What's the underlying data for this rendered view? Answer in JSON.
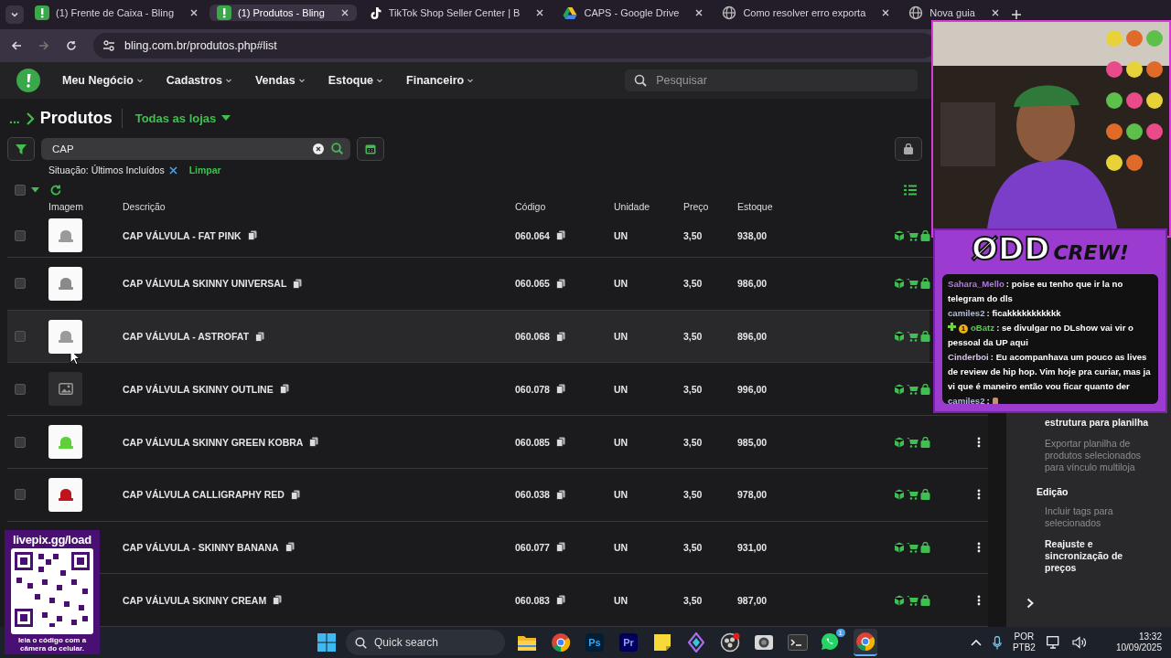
{
  "browser": {
    "tabs": [
      {
        "title": "(1) Frente de Caixa - Bling",
        "kind": "bling",
        "selected": false
      },
      {
        "title": "(1) Produtos - Bling",
        "kind": "bling",
        "selected": true
      },
      {
        "title": "TikTok Shop Seller Center | B",
        "kind": "note",
        "selected": false
      },
      {
        "title": "CAPS - Google Drive",
        "kind": "drive",
        "selected": false
      },
      {
        "title": "Como resolver erro exporta",
        "kind": "globe",
        "selected": false
      },
      {
        "title": "Nova guia",
        "kind": "globe",
        "selected": false
      }
    ],
    "url": "bling.com.br/produtos.php#list"
  },
  "nav": {
    "items": [
      "Meu Negócio",
      "Cadastros",
      "Vendas",
      "Estoque",
      "Financeiro"
    ],
    "search_placeholder": "Pesquisar"
  },
  "page": {
    "breadcrumb": "...",
    "title": "Produtos",
    "store_filter": "Todas as lojas",
    "search_value": "CAP",
    "filter_chip": "Situação: Últimos Incluídos",
    "clear_link": "Limpar"
  },
  "table": {
    "select_all_checked": false,
    "columns": [
      "Imagem",
      "Descrição",
      "Código",
      "Unidade",
      "Preço",
      "Estoque"
    ],
    "rows": [
      {
        "checked": false,
        "image": {
          "kind": "thumbnail",
          "color": "#9a9a9a"
        },
        "description": "CAP VÁLVULA - FAT PINK",
        "code": "060.064",
        "unit": "UN",
        "price": "3,50",
        "stock": "938,00",
        "highlighted": false
      },
      {
        "checked": false,
        "image": {
          "kind": "thumbnail",
          "color": "#8a8a8a"
        },
        "description": "CAP VÁLVULA SKINNY UNIVERSAL",
        "code": "060.065",
        "unit": "UN",
        "price": "3,50",
        "stock": "986,00",
        "highlighted": false
      },
      {
        "checked": false,
        "image": {
          "kind": "thumbnail",
          "color": "#9a9a9a"
        },
        "description": "CAP VÁLVULA - ASTROFAT",
        "code": "060.068",
        "unit": "UN",
        "price": "3,50",
        "stock": "896,00",
        "highlighted": true
      },
      {
        "checked": false,
        "image": {
          "kind": "placeholder"
        },
        "description": "CAP VÁLVULA SKINNY OUTLINE",
        "code": "060.078",
        "unit": "UN",
        "price": "3,50",
        "stock": "996,00",
        "highlighted": false
      },
      {
        "checked": false,
        "image": {
          "kind": "thumbnail",
          "color": "#5fcf3a"
        },
        "description": "CAP VÁLVULA SKINNY GREEN KOBRA",
        "code": "060.085",
        "unit": "UN",
        "price": "3,50",
        "stock": "985,00",
        "highlighted": false,
        "actions_menu": true
      },
      {
        "checked": false,
        "image": {
          "kind": "thumbnail",
          "color": "#c0141c"
        },
        "description": "CAP VÁLVULA CALLIGRAPHY RED",
        "code": "060.038",
        "unit": "UN",
        "price": "3,50",
        "stock": "978,00",
        "highlighted": false,
        "actions_menu": true
      },
      {
        "image": {
          "kind": "hidden"
        },
        "description": "CAP VÁLVULA - SKINNY BANANA",
        "code": "060.077",
        "unit": "UN",
        "price": "3,50",
        "stock": "931,00",
        "highlighted": false,
        "actions_menu": true
      },
      {
        "image": {
          "kind": "hidden"
        },
        "description": "CAP VÁLVULA SKINNY CREAM",
        "code": "060.083",
        "unit": "UN",
        "price": "3,50",
        "stock": "987,00",
        "highlighted": false,
        "actions_menu": true
      }
    ]
  },
  "side_panel": {
    "items": [
      {
        "kind": "item",
        "text": "estrutura para planilha",
        "disabled": false
      },
      {
        "kind": "item",
        "text": "Exportar planilha de produtos selecionados para vínculo multiloja",
        "disabled": true
      },
      {
        "kind": "heading",
        "text": "Edição"
      },
      {
        "kind": "item",
        "text": "Incluir tags para selecionados",
        "disabled": true
      },
      {
        "kind": "item",
        "text": "Reajuste e sincronização de preços",
        "disabled": false
      }
    ]
  },
  "stream": {
    "logo": "ØDD",
    "logo_suffix": "CREW!",
    "chat": [
      {
        "user": "Sahara_Mello",
        "color": "#b07ad8",
        "kind": "text",
        "text": ": poise eu tenho que ir la no telegram do dls"
      },
      {
        "user": "camiles2",
        "color": "#a9bce0",
        "kind": "text",
        "text": ": ficakkkkkkkkkkk"
      },
      {
        "user": "oBatz",
        "color": "#59c94f",
        "kind": "text",
        "badge": "1",
        "text": ": se divulgar no DLshow vai vir o pessoal da UP aqui"
      },
      {
        "user": "Cinderboi",
        "color": "#d9c3ef",
        "kind": "text",
        "text": ": Eu acompanhava um pouco as lives de review de hip hop. Vim hoje pra curiar, mas ja vi que é maneiro então vou ficar quanto der"
      },
      {
        "user": "camiles2",
        "color": "#a9bce0",
        "kind": "emote",
        "text": ":"
      }
    ],
    "qr_title": "livepix.gg/load",
    "qr_caption": "leia o código com a câmera do celular."
  },
  "taskbar": {
    "search_placeholder": "Quick search",
    "apps": [
      {
        "kind": "folder"
      },
      {
        "kind": "chrome"
      },
      {
        "kind": "photoshop",
        "label": "Ps"
      },
      {
        "kind": "premiere",
        "label": "Pr"
      },
      {
        "kind": "notes"
      },
      {
        "kind": "diamond"
      },
      {
        "kind": "obs",
        "alert": true
      },
      {
        "kind": "camera"
      },
      {
        "kind": "terminal"
      },
      {
        "kind": "whatsapp",
        "badge": "1"
      },
      {
        "kind": "chrome",
        "active": true
      }
    ],
    "language": "POR",
    "layout": "PTB2",
    "time": "13:32",
    "date": "10/09/2025"
  }
}
